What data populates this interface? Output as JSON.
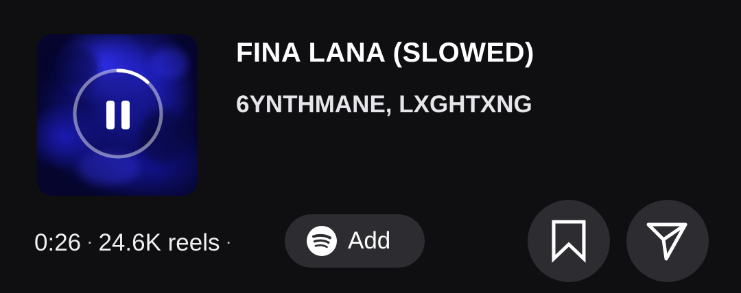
{
  "track": {
    "title": "FINA LANA (SLOWED)",
    "artist": "6YNTHMANE, LXGHTXNG",
    "duration": "0:26",
    "separator": "·",
    "reels_count": "24.6K reels",
    "playback_progress": 0.12,
    "state": "playing"
  },
  "actions": {
    "add_label": "Add",
    "add_service_icon": "spotify-icon",
    "save_icon": "bookmark-icon",
    "share_icon": "send-icon"
  },
  "colors": {
    "background": "#0f0f12",
    "button_bg": "#2c2c31",
    "cover_tint": "#1818a6",
    "text": "#ffffff"
  }
}
